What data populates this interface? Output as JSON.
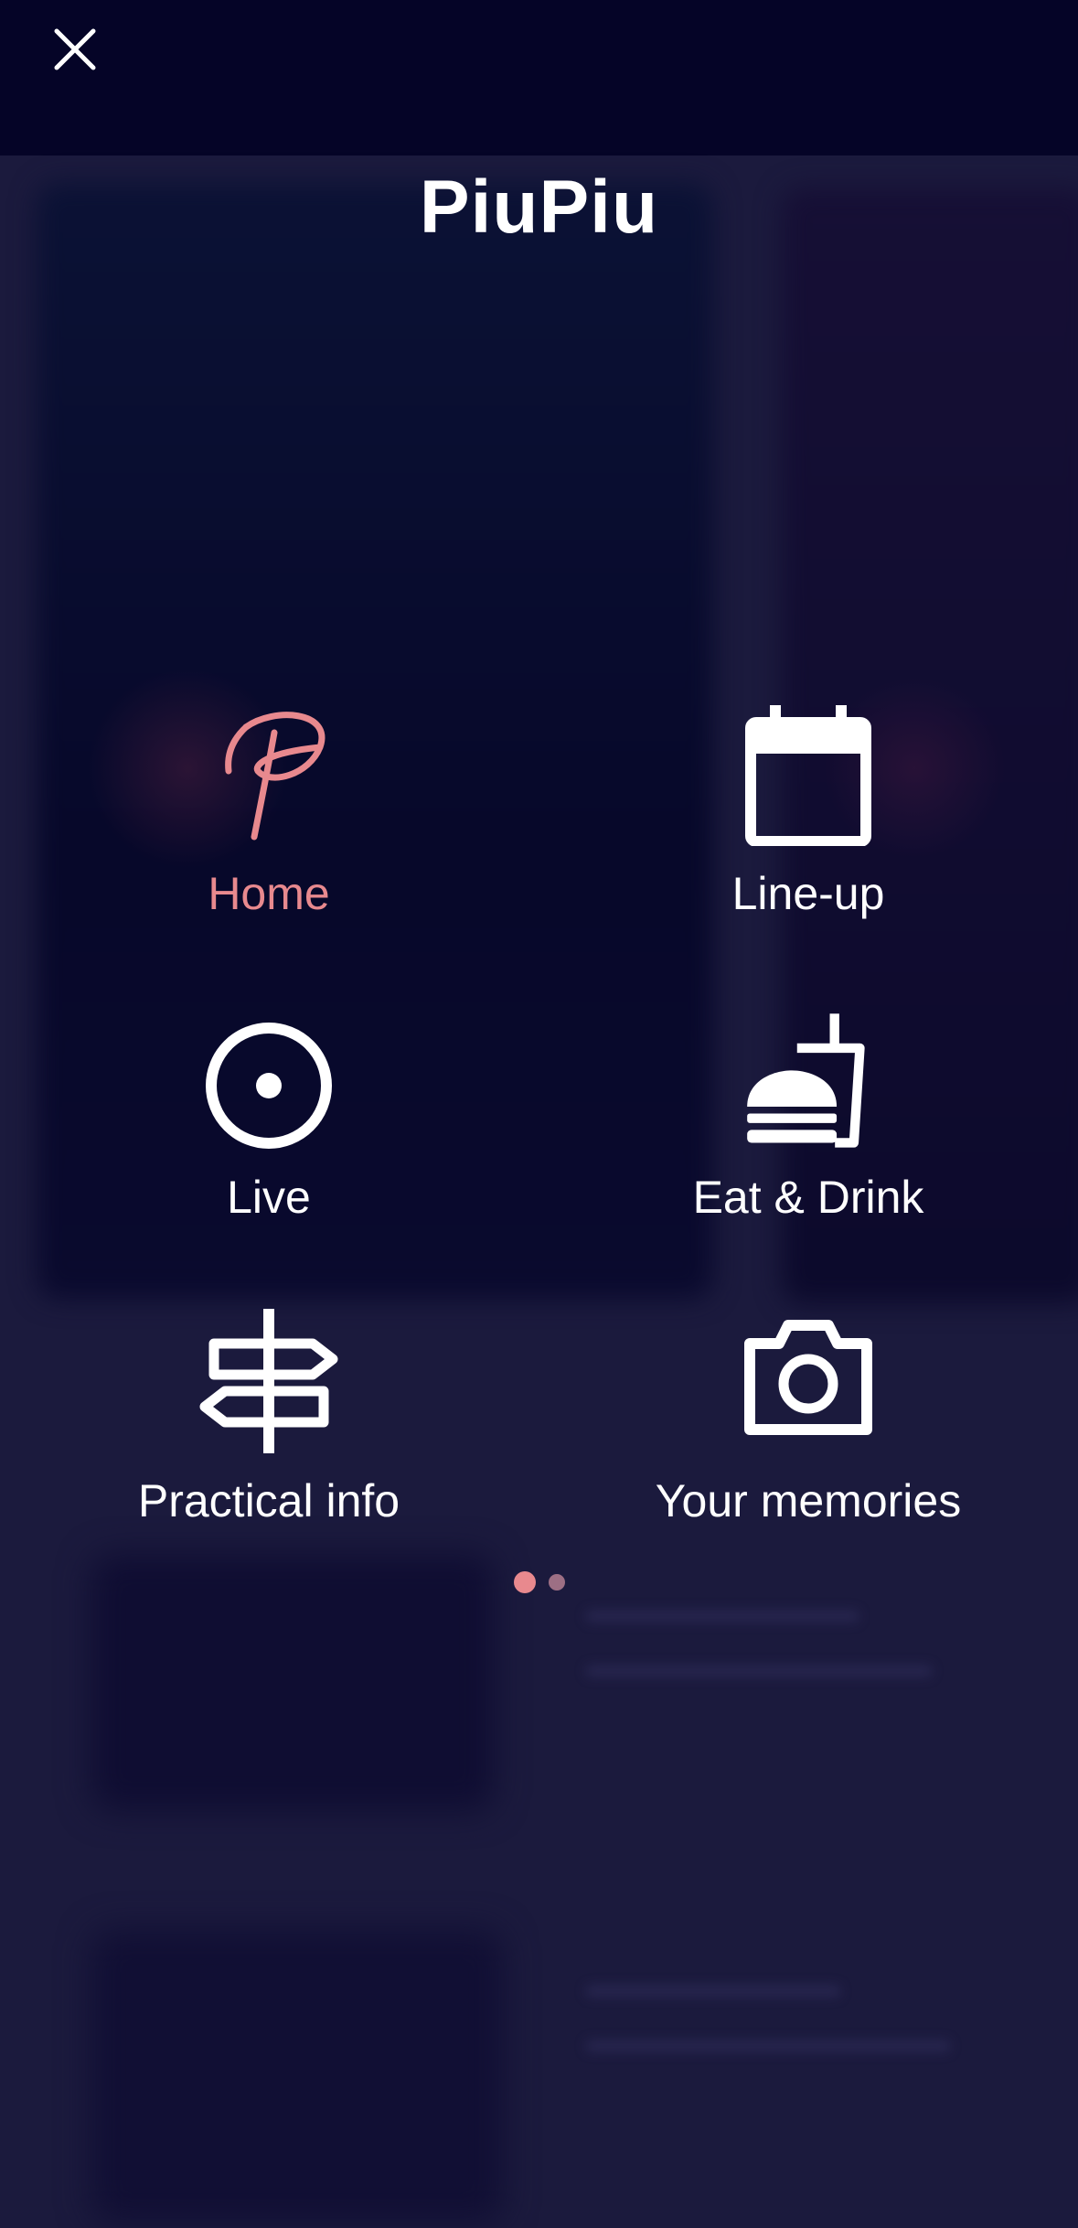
{
  "header": {
    "close_label": "close",
    "title": "PiuPiu"
  },
  "menu": {
    "items": [
      {
        "label": "Home",
        "icon": "piupiu-logo-icon",
        "active": true
      },
      {
        "label": "Line-up",
        "icon": "calendar-icon",
        "active": false
      },
      {
        "label": "Live",
        "icon": "live-target-icon",
        "active": false
      },
      {
        "label": "Eat & Drink",
        "icon": "burger-drink-icon",
        "active": false
      },
      {
        "label": "Practical info",
        "icon": "signpost-icon",
        "active": false
      },
      {
        "label": "Your memories",
        "icon": "camera-icon",
        "active": false
      }
    ]
  },
  "pager": {
    "current": 1,
    "total": 2
  },
  "colors": {
    "accent": "#e8898e",
    "background": "#1b1a3d",
    "top_bar": "#050427",
    "text": "#ffffff"
  }
}
